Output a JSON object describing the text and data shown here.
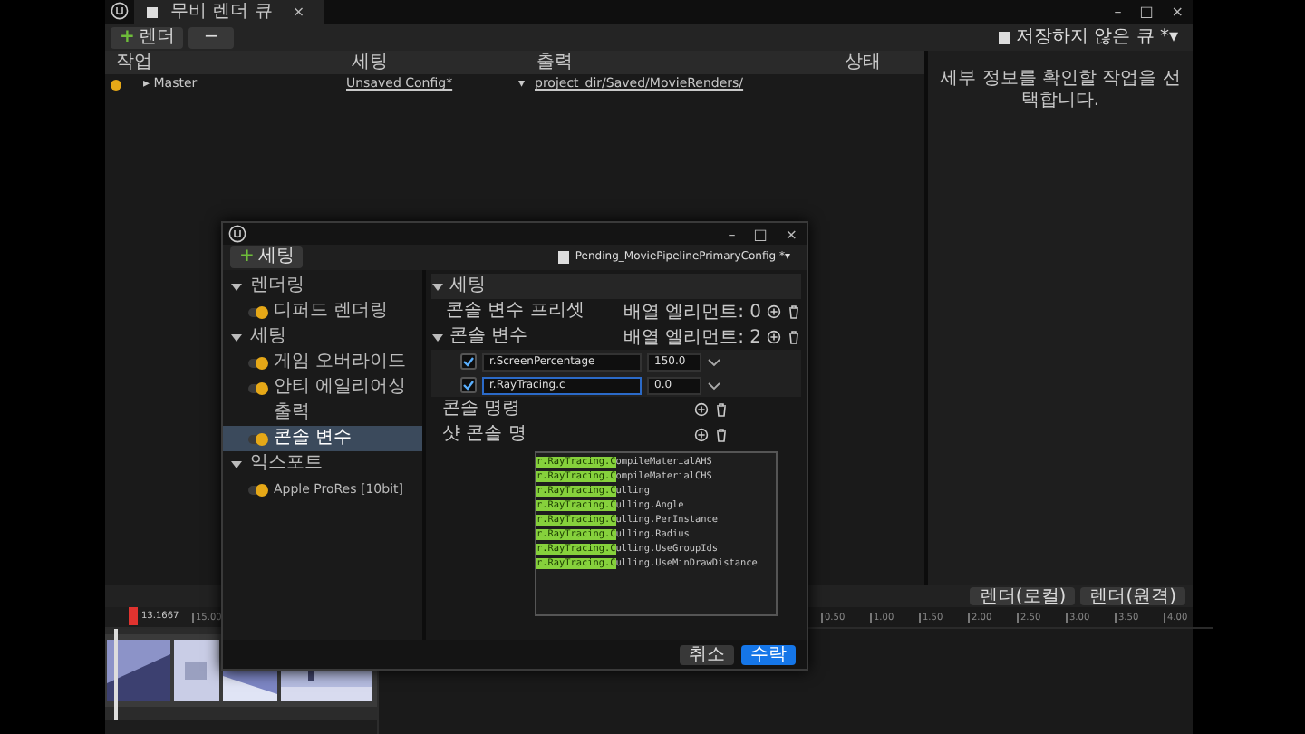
{
  "window": {
    "tab": "무비 렌더 큐",
    "tab_close": "×",
    "controls": [
      "–",
      "□",
      "×"
    ]
  },
  "toolbar": {
    "add": "렌더",
    "add_icon": "+",
    "remove": "−",
    "queue": "저장하지 않은 큐 *▾"
  },
  "jobs": {
    "columns": [
      "작업",
      "세팅",
      "출력",
      "상태"
    ],
    "rows": [
      {
        "on": true,
        "expand": "▸",
        "job": "Master",
        "settings": "Unsaved Config*",
        "drop": "▾",
        "output": "project_dir/Saved/MovieRenders/"
      }
    ]
  },
  "details": {
    "message": "세부 정보를 확인할 작업을 선택합니다."
  },
  "render_buttons": [
    "렌더(로컬)",
    "렌더(원격)"
  ],
  "timeline": {
    "playhead": "13.1667",
    "left_ticks": [
      "15.00"
    ],
    "ticks": [
      "0.50",
      "1.00",
      "1.50",
      "2.00",
      "2.50",
      "3.00",
      "3.50",
      "4.00"
    ],
    "clips": {
      "kind": "picture"
    }
  },
  "dialog": {
    "controls": [
      "–",
      "□",
      "×"
    ],
    "add": "세팅",
    "add_icon": "+",
    "config": "Pending_MoviePipelinePrimaryConfig *▾",
    "sidebar": [
      {
        "label": "렌더링",
        "expanded": true,
        "children": [
          {
            "label": "디퍼드 렌더링",
            "on": true,
            "selected": false
          }
        ]
      },
      {
        "label": "세팅",
        "expanded": true,
        "children": [
          {
            "label": "게임 오버라이드",
            "on": true,
            "selected": false
          },
          {
            "label": "안티 에일리어싱",
            "on": true,
            "selected": false
          },
          {
            "label": "출력",
            "selected": false
          },
          {
            "label": "콘솔 변수",
            "on": true,
            "selected": true
          }
        ]
      },
      {
        "label": "익스포트",
        "expanded": true,
        "children": [
          {
            "label": "Apple ProRes [10bit]",
            "on": true,
            "selected": false
          }
        ]
      }
    ],
    "section": {
      "label": "세팅",
      "expanded": true
    },
    "preset": {
      "label": "콘솔 변수 프리셋",
      "count": "배열 엘리먼트: 0"
    },
    "cvars": {
      "label": "콘솔 변수",
      "expanded": true,
      "count": "배열 엘리먼트: 2",
      "items": [
        {
          "checked": true,
          "name": "r.ScreenPercentage",
          "value": "150.0",
          "focused": false
        },
        {
          "checked": true,
          "name": "r.RayTracing.c",
          "value": "0.0",
          "focused": true
        }
      ]
    },
    "cut_rows": [
      "콘솔 명령",
      "샷 콘솔 명"
    ],
    "suggestions": [
      {
        "match": "r.RayTracing.C",
        "rest": "ompileMaterialAHS"
      },
      {
        "match": "r.RayTracing.C",
        "rest": "ompileMaterialCHS"
      },
      {
        "match": "r.RayTracing.C",
        "rest": "ulling"
      },
      {
        "match": "r.RayTracing.C",
        "rest": "ulling.Angle"
      },
      {
        "match": "r.RayTracing.C",
        "rest": "ulling.PerInstance"
      },
      {
        "match": "r.RayTracing.C",
        "rest": "ulling.Radius"
      },
      {
        "match": "r.RayTracing.C",
        "rest": "ulling.UseGroupIds"
      },
      {
        "match": "r.RayTracing.C",
        "rest": "ulling.UseMinDrawDistance"
      }
    ],
    "buttons": [
      {
        "label": "취소",
        "primary": false
      },
      {
        "label": "수락",
        "primary": true
      }
    ]
  }
}
